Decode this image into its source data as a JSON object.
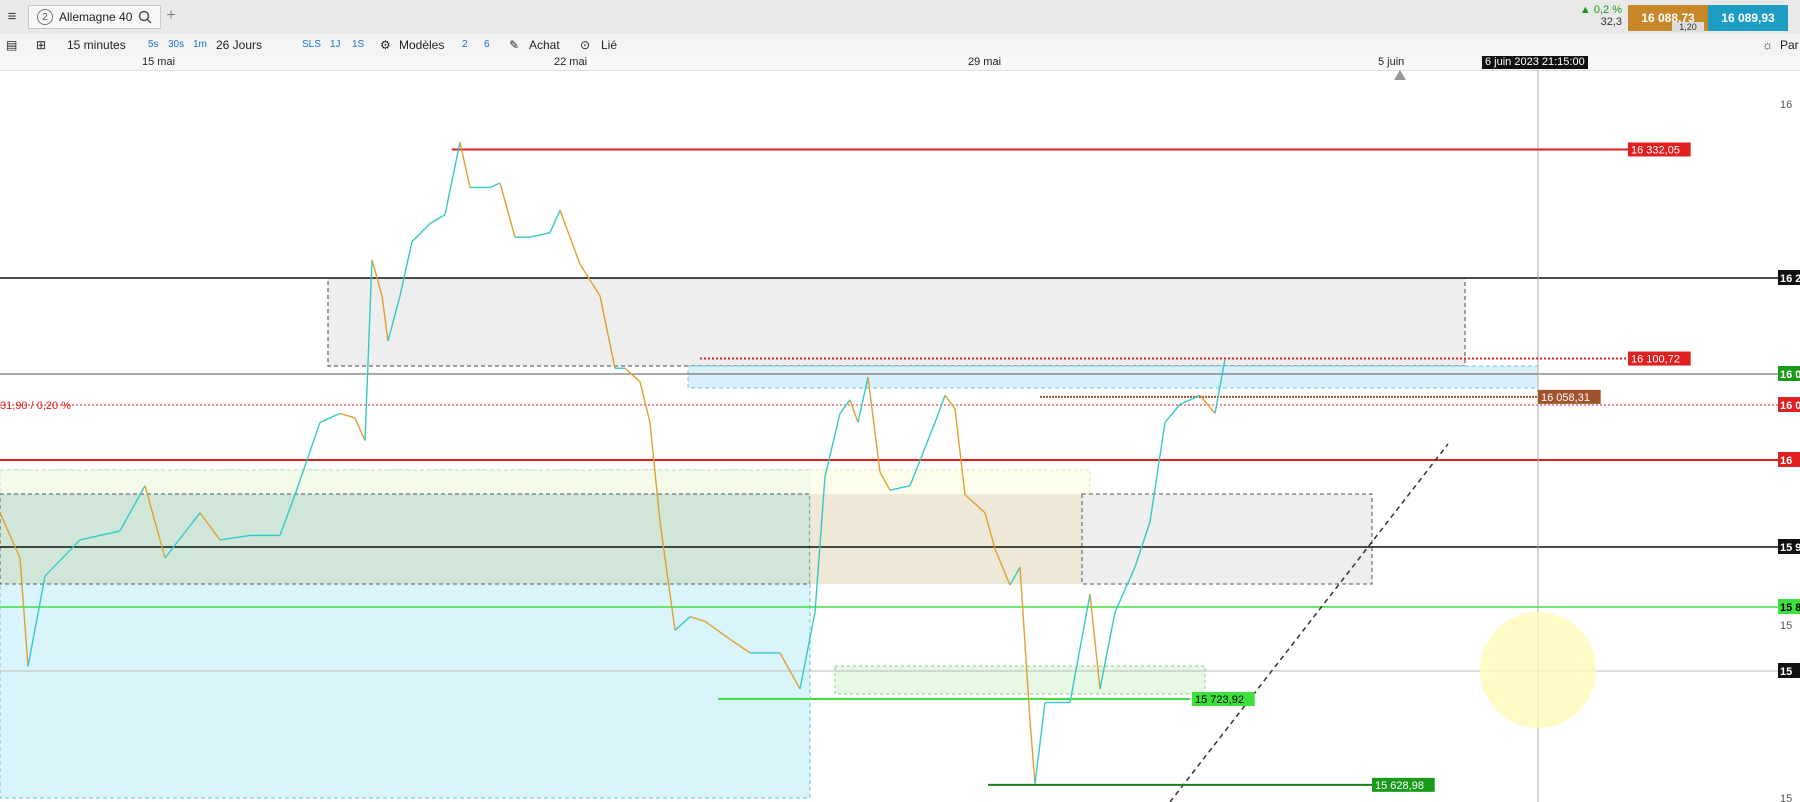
{
  "toolbar": {
    "menu_icon": "hamburger-icon",
    "instrument_index": "2",
    "instrument": "Allemagne 40",
    "add_tab": "+",
    "change_pct": "▲ 0,2 %",
    "change_pts": "32,3",
    "bid": "16 088,73",
    "ask": "16 089,93",
    "spread": "1,20",
    "params_label": "Par"
  },
  "toolbar2": {
    "timeframe": "15 minutes",
    "quick_tf": [
      "5s",
      "30s",
      "1m"
    ],
    "period": "26 Jours",
    "quick_p": [
      "SLS",
      "1J",
      "1S"
    ],
    "models": "Modèles",
    "n1": "2",
    "n2": "6",
    "buy": "Achat",
    "linked": "Lié"
  },
  "timeaxis": {
    "labels": [
      "15 mai",
      "22 mai",
      "29 mai",
      "5 juin"
    ],
    "cursor_label": "6 juin 2023 21:15:00"
  },
  "chart_data": {
    "type": "line",
    "title": "Allemagne 40",
    "timeframe": "15 minutes",
    "x_labels": [
      "15 mai",
      "22 mai",
      "29 mai",
      "5 juin"
    ],
    "ylim": [
      15610,
      16420
    ],
    "series": [
      {
        "points": [
          [
            0,
            15930
          ],
          [
            20,
            15880
          ],
          [
            28,
            15760
          ],
          [
            45,
            15860
          ],
          [
            80,
            15900
          ],
          [
            120,
            15910
          ],
          [
            145,
            15960
          ],
          [
            165,
            15880
          ],
          [
            200,
            15930
          ],
          [
            220,
            15900
          ],
          [
            250,
            15905
          ],
          [
            280,
            15905
          ],
          [
            295,
            15950
          ],
          [
            320,
            16030
          ],
          [
            340,
            16040
          ],
          [
            355,
            16035
          ],
          [
            365,
            16010
          ],
          [
            372,
            16210
          ],
          [
            382,
            16170
          ],
          [
            388,
            16120
          ],
          [
            400,
            16170
          ],
          [
            412,
            16230
          ],
          [
            430,
            16250
          ],
          [
            445,
            16260
          ],
          [
            460,
            16340
          ],
          [
            470,
            16290
          ],
          [
            490,
            16290
          ],
          [
            500,
            16295
          ],
          [
            515,
            16235
          ],
          [
            530,
            16235
          ],
          [
            550,
            16240
          ],
          [
            560,
            16265
          ],
          [
            580,
            16205
          ],
          [
            600,
            16170
          ],
          [
            615,
            16090
          ],
          [
            625,
            16090
          ],
          [
            640,
            16075
          ],
          [
            650,
            16030
          ],
          [
            660,
            15920
          ],
          [
            675,
            15800
          ],
          [
            690,
            15815
          ],
          [
            705,
            15810
          ],
          [
            730,
            15790
          ],
          [
            750,
            15775
          ],
          [
            780,
            15775
          ],
          [
            800,
            15735
          ],
          [
            815,
            15820
          ],
          [
            825,
            15970
          ],
          [
            840,
            16040
          ],
          [
            850,
            16055
          ],
          [
            858,
            16030
          ],
          [
            868,
            16080
          ],
          [
            880,
            15975
          ],
          [
            890,
            15955
          ],
          [
            910,
            15960
          ],
          [
            935,
            16030
          ],
          [
            945,
            16060
          ],
          [
            955,
            16045
          ],
          [
            965,
            15950
          ],
          [
            985,
            15930
          ],
          [
            995,
            15890
          ],
          [
            1010,
            15850
          ],
          [
            1020,
            15870
          ],
          [
            1030,
            15700
          ],
          [
            1035,
            15630
          ],
          [
            1045,
            15720
          ],
          [
            1070,
            15720
          ],
          [
            1090,
            15840
          ],
          [
            1100,
            15735
          ],
          [
            1115,
            15820
          ],
          [
            1135,
            15870
          ],
          [
            1150,
            15920
          ],
          [
            1165,
            16030
          ],
          [
            1180,
            16050
          ],
          [
            1200,
            16060
          ],
          [
            1215,
            16040
          ],
          [
            1225,
            16100
          ]
        ]
      }
    ],
    "horizontal_levels": [
      16332.05,
      16100.72,
      16058.31,
      15723.92,
      15628.98
    ],
    "level_labels": [
      "16 332,05",
      "16 100,72",
      "16 058,31",
      "15 723,92",
      "15 628,98"
    ],
    "edge_labels": [
      "16",
      "16 2",
      "16 0",
      "16",
      "16 0",
      "15 9",
      "15 8",
      "15",
      "15",
      "15"
    ],
    "left_annotation": "31,90 / 0,20 %",
    "colors": {
      "price_line_up": "#33c9c9",
      "price_line_down": "#e0a030",
      "resistance": "#e02020",
      "support": "#1fa01f",
      "zone_blue": "#d9f4fa",
      "zone_green": "#cfe6d9",
      "zone_grey": "#eeeeee",
      "brown_label": "#a0522d"
    }
  }
}
